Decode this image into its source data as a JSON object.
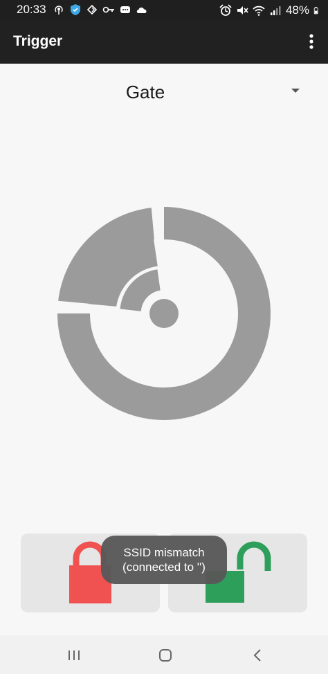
{
  "status_bar": {
    "time": "20:33",
    "battery": "48%",
    "left_icons": [
      "broadcast-icon",
      "shield-icon",
      "sync-icon",
      "key-icon",
      "message-icon",
      "cloud-icon"
    ],
    "right_icons": [
      "alarm-icon",
      "mute-icon",
      "wifi-icon",
      "signal-icon",
      "battery-icon"
    ]
  },
  "app_bar": {
    "title": "Trigger"
  },
  "selector": {
    "value": "Gate"
  },
  "locks": {
    "lock_color": "#f05252",
    "unlock_color": "#2e9e5b"
  },
  "toast": {
    "line1": "SSID mismatch",
    "line2": "(connected to '')"
  },
  "colors": {
    "graphic_gray": "#9b9b9b",
    "app_bar": "#212121",
    "panel": "#e6e6e6"
  }
}
